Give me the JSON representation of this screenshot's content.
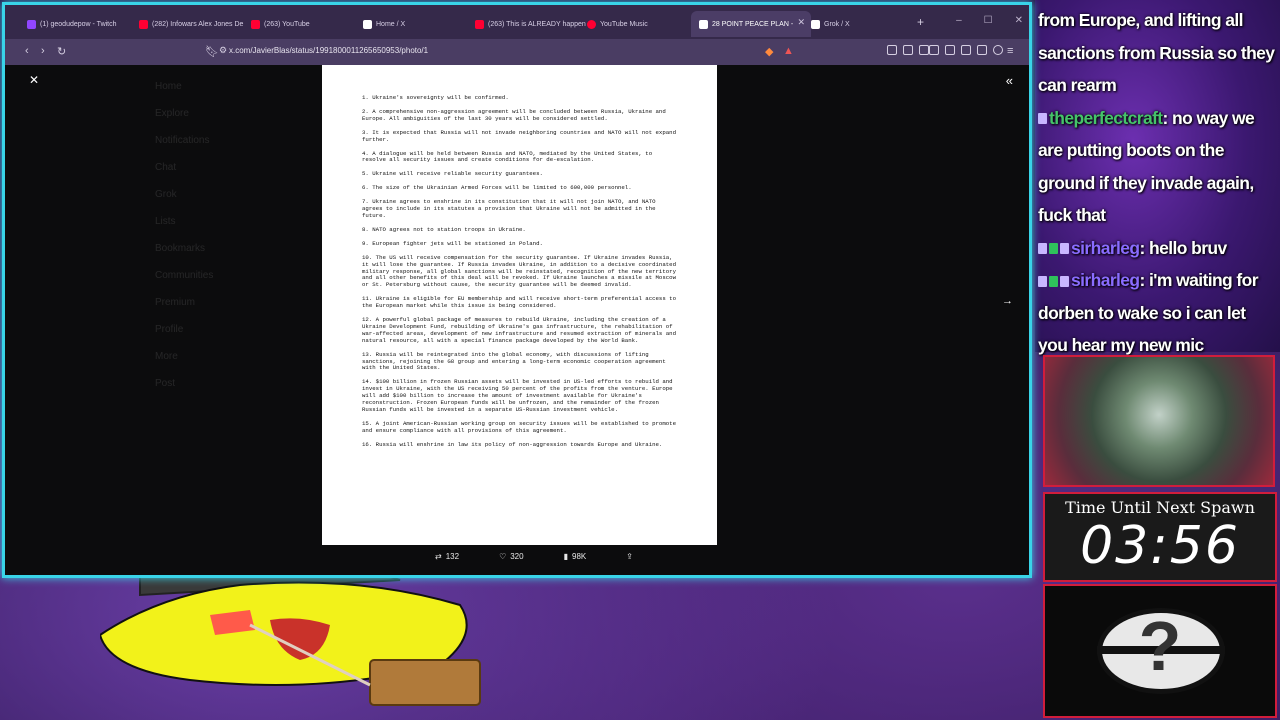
{
  "browser": {
    "tabs": [
      {
        "label": "(1) geodudepow - Twitch",
        "color": "#9146ff"
      },
      {
        "label": "(282) Infowars Alex Jones De",
        "color": "#ff0033"
      },
      {
        "label": "(263) YouTube",
        "color": "#ff0033"
      },
      {
        "label": "Home / X",
        "color": "#ffffff"
      },
      {
        "label": "(263) This is ALREADY happen",
        "color": "#ff0033"
      },
      {
        "label": "YouTube Music",
        "color": "#ff0033"
      },
      {
        "label": "28 POINT PEACE PLAN -",
        "color": "#ffffff",
        "active": true
      },
      {
        "label": "Grok / X",
        "color": "#ffffff"
      }
    ],
    "url": "x.com/JavierBlas/status/1991800011265650953/photo/1"
  },
  "twitter_bg": {
    "nav": [
      "Home",
      "Explore",
      "Notifications",
      "Chat",
      "Grok",
      "Lists",
      "Bookmarks",
      "Communities",
      "Premium",
      "Profile",
      "More"
    ],
    "post_button": "Post"
  },
  "document": {
    "paragraphs": [
      "1. Ukraine's sovereignty will be confirmed.",
      "2. A comprehensive non-aggression agreement will be concluded between Russia, Ukraine and Europe. All ambiguities of the last 30 years will be considered settled.",
      "3. It is expected that Russia will not invade neighboring countries and NATO will not expand further.",
      "4. A dialogue will be held between Russia and NATO, mediated by the United States, to resolve all security issues and create conditions for de-escalation.",
      "5. Ukraine will receive reliable security guarantees.",
      "6. The size of the Ukrainian Armed Forces will be limited to 600,000 personnel.",
      "7. Ukraine agrees to enshrine in its constitution that it will not join NATO, and NATO agrees to include in its statutes a provision that Ukraine will not be admitted in the future.",
      "8. NATO agrees not to station troops in Ukraine.",
      "9. European fighter jets will be stationed in Poland.",
      "10. The US will receive compensation for the security guarantee. If Ukraine invades Russia, it will lose the guarantee. If Russia invades Ukraine, in addition to a decisive coordinated military response, all global sanctions will be reinstated, recognition of the new territory and all other benefits of this deal will be revoked. If Ukraine launches a missile at Moscow or St. Petersburg without cause, the security guarantee will be deemed invalid.",
      "11. Ukraine is eligible for EU membership and will receive short-term preferential access to the European market while this issue is being considered.",
      "12. A powerful global package of measures to rebuild Ukraine, including the creation of a Ukraine Development Fund, rebuilding of Ukraine's gas infrastructure, the rehabilitation of war-affected areas, development of new infrastructure and resumed extraction of minerals and natural resource, all with a special finance package developed by the World Bank.",
      "13. Russia will be reintegrated into the global economy, with discussions of lifting sanctions, rejoining the G8 group and entering a long-term economic cooperation agreement with the United States.",
      "14. $100 billion in frozen Russian assets will be invested in US-led efforts to rebuild and invest in Ukraine, with the US receiving 50 percent of the profits from the venture. Europe will add $100 billion to increase the amount of investment available for Ukraine's reconstruction. Frozen European funds will be unfrozen, and the remainder of the frozen Russian funds will be invested in a separate US-Russian investment vehicle.",
      "15. A joint American-Russian working group on security issues will be established to promote and ensure compliance with all provisions of this agreement.",
      "16. Russia will enshrine in law its policy of non-aggression towards Europe and Ukraine."
    ]
  },
  "post_actions": {
    "reposts": "132",
    "likes": "320",
    "views": "98K"
  },
  "chat": {
    "line0": "from Europe, and lifting all sanctions from Russia so they can rearm",
    "msg1_user": "theperfectcraft",
    "msg1_text": ": no way we are putting boots on the ground if they invade again, fuck that",
    "msg2_user": "sirharleg",
    "msg2_text": ": hello bruv",
    "msg3_user": "sirharleg",
    "msg3_text": ": i'm waiting for dorben to wake so i can let you hear my new mic"
  },
  "timer": {
    "label": "Time Until Next Spawn",
    "value": "03:56"
  },
  "colors": {
    "frame": "#39d4e8",
    "panel_border": "#d11d3c"
  }
}
